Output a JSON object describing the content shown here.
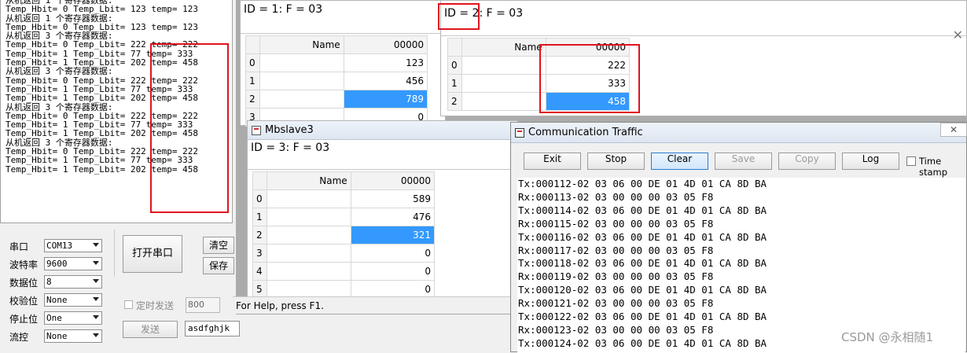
{
  "serial_tool": {
    "log_lines": [
      "从机返回 1 个寄存器数据:",
      "Temp_Hbit= 0 Temp_Lbit= 123 temp= 123",
      "从机返回 1 个寄存器数据:",
      "Temp_Hbit= 0 Temp_Lbit= 123 temp= 123",
      "从机返回 3 个寄存器数据:",
      "Temp_Hbit= 0 Temp_Lbit= 222 temp= 222",
      "Temp_Hbit= 1 Temp_Lbit= 77 temp= 333",
      "Temp_Hbit= 1 Temp_Lbit= 202 temp= 458",
      "从机返回 3 个寄存器数据:",
      "Temp_Hbit= 0 Temp_Lbit= 222 temp= 222",
      "Temp_Hbit= 1 Temp_Lbit= 77 temp= 333",
      "Temp_Hbit= 1 Temp_Lbit= 202 temp= 458",
      "从机返回 3 个寄存器数据:",
      "Temp_Hbit= 0 Temp_Lbit= 222 temp= 222",
      "Temp_Hbit= 1 Temp_Lbit= 77 temp= 333",
      "Temp_Hbit= 1 Temp_Lbit= 202 temp= 458",
      "从机返回 3 个寄存器数据:",
      "Temp_Hbit= 0 Temp_Lbit= 222 temp= 222",
      "Temp_Hbit= 1 Temp_Lbit= 77 temp= 333",
      "Temp_Hbit= 1 Temp_Lbit= 202 temp= 458"
    ],
    "labels": {
      "port": "串口",
      "baud": "波特率",
      "databits": "数据位",
      "parity": "校验位",
      "stopbits": "停止位",
      "flow": "流控"
    },
    "values": {
      "port": "COM13",
      "baud": "9600",
      "databits": "8",
      "parity": "None",
      "stopbits": "One",
      "flow": "None"
    },
    "open_port_button": "打开串口",
    "clear_button": "清空",
    "save_button": "保存",
    "timed_send_label": "定时发送",
    "timed_send_ms": "800",
    "send_button": "发送",
    "send_text": "asdfghjk"
  },
  "mbslave1": {
    "header": "ID = 1: F = 03",
    "col_header": "00000",
    "name_header": "Name",
    "rows": [
      {
        "index": "0",
        "value": "123"
      },
      {
        "index": "1",
        "value": "456"
      },
      {
        "index": "2",
        "value": "789"
      },
      {
        "index": "3",
        "value": "0"
      }
    ]
  },
  "mbslave2": {
    "header": "ID = 2: F = 03",
    "col_header": "00000",
    "name_header": "Name",
    "rows": [
      {
        "index": "0",
        "value": "222"
      },
      {
        "index": "1",
        "value": "333"
      },
      {
        "index": "2",
        "value": "458"
      }
    ]
  },
  "mbslave3": {
    "title": "Mbslave3",
    "header": "ID = 3: F = 03",
    "col_header": "00000",
    "name_header": "Name",
    "rows": [
      {
        "index": "0",
        "value": "589"
      },
      {
        "index": "1",
        "value": "476"
      },
      {
        "index": "2",
        "value": "321"
      },
      {
        "index": "3",
        "value": "0"
      },
      {
        "index": "4",
        "value": "0"
      },
      {
        "index": "5",
        "value": "0"
      }
    ],
    "status": "For Help, press F1."
  },
  "traffic": {
    "title": "Communication Traffic",
    "buttons": {
      "exit": "Exit",
      "stop": "Stop",
      "clear": "Clear",
      "save": "Save",
      "copy": "Copy",
      "log": "Log"
    },
    "timestamp_label": "Time stamp",
    "lines": [
      "Tx:000112-02 03 06 00 DE 01 4D 01 CA 8D BA",
      "Rx:000113-02 03 00 00 00 03 05 F8",
      "Tx:000114-02 03 06 00 DE 01 4D 01 CA 8D BA",
      "Rx:000115-02 03 00 00 00 03 05 F8",
      "Tx:000116-02 03 06 00 DE 01 4D 01 CA 8D BA",
      "Rx:000117-02 03 00 00 00 03 05 F8",
      "Tx:000118-02 03 06 00 DE 01 4D 01 CA 8D BA",
      "Rx:000119-02 03 00 00 00 03 05 F8",
      "Tx:000120-02 03 06 00 DE 01 4D 01 CA 8D BA",
      "Rx:000121-02 03 00 00 00 03 05 F8",
      "Tx:000122-02 03 06 00 DE 01 4D 01 CA 8D BA",
      "Rx:000123-02 03 00 00 00 03 05 F8",
      "Tx:000124-02 03 06 00 DE 01 4D 01 CA 8D BA"
    ]
  },
  "watermark": "CSDN @永相随1",
  "colors": {
    "highlight": "#3399ff",
    "annotation": "#e0141e"
  }
}
